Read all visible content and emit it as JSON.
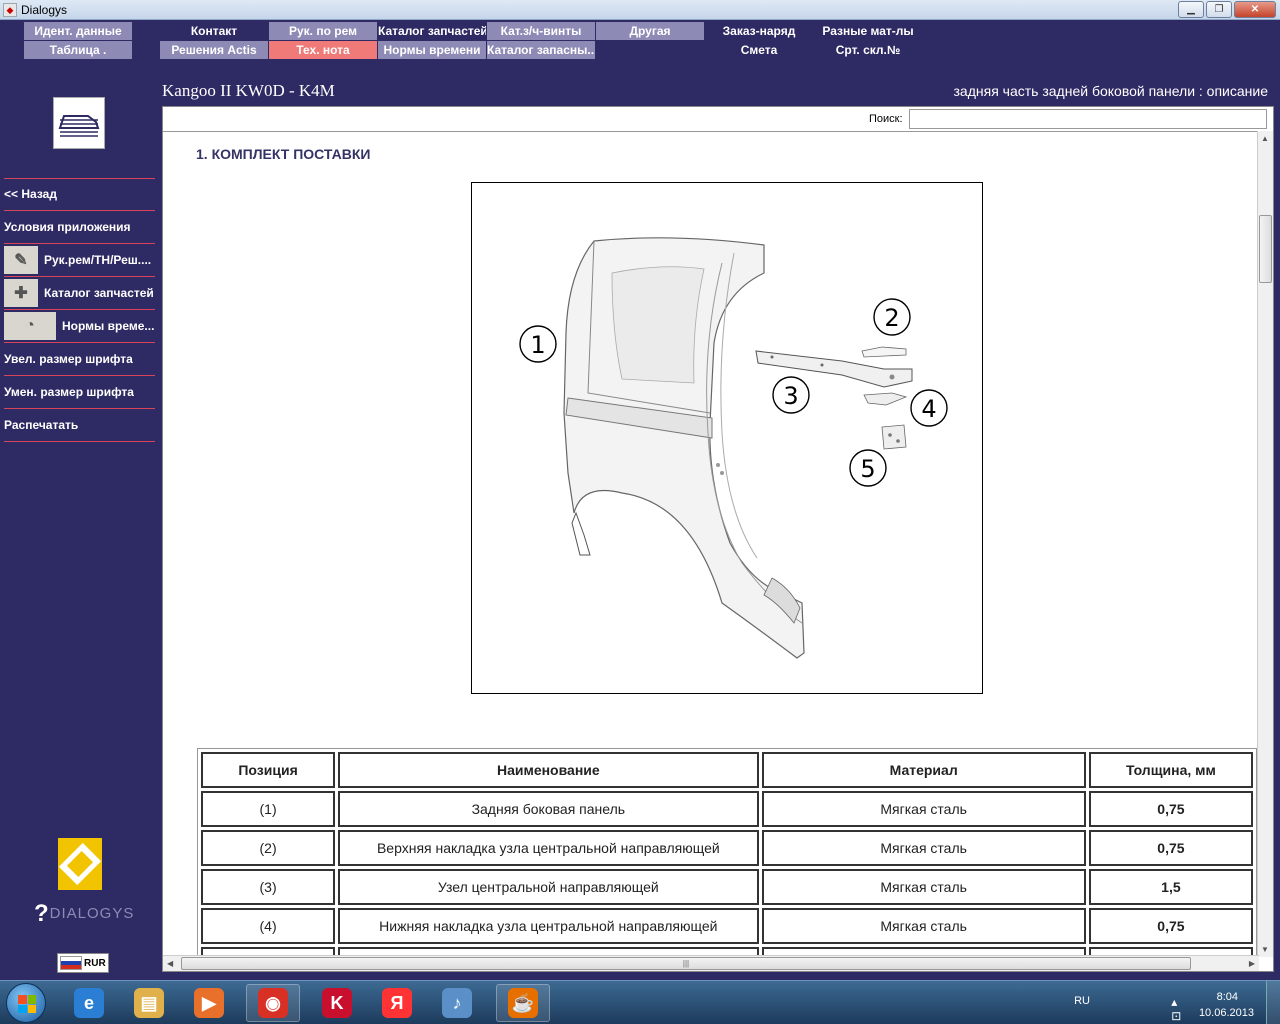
{
  "window": {
    "title": "Dialogys",
    "minimize": "▁",
    "restore": "❐",
    "close": "✕"
  },
  "nav": {
    "row1": [
      {
        "label": "Идент. данные",
        "style": "grey"
      },
      {
        "label": "Контакт",
        "style": "dark"
      },
      {
        "label": "Рук. по рем",
        "style": "grey"
      },
      {
        "label": "Каталог запчастей",
        "style": "dark"
      },
      {
        "label": "Кат.з/ч-винты",
        "style": "grey"
      },
      {
        "label": "Другая",
        "style": "grey"
      },
      {
        "label": "Заказ-наряд",
        "style": "dark"
      },
      {
        "label": "Разные мат-лы",
        "style": "dark"
      }
    ],
    "row2": [
      {
        "label": "Таблица .",
        "style": "grey"
      },
      {
        "label": "Решения Actis",
        "style": "grey"
      },
      {
        "label": "Тех. нота",
        "style": "active"
      },
      {
        "label": "Нормы времени",
        "style": "grey"
      },
      {
        "label": "Каталог запасны...",
        "style": "grey"
      },
      {
        "label": "Смета",
        "style": "dark"
      },
      {
        "label": "Срт. скл.№",
        "style": "dark"
      }
    ]
  },
  "header": {
    "model": "Kangoo II KW0D - K4M",
    "description": "задняя часть задней боковой панели : описание"
  },
  "sidebar": {
    "items": [
      {
        "label": "<< Назад",
        "icon": ""
      },
      {
        "label": "Условия приложения",
        "icon": ""
      },
      {
        "label": "Рук.рем/ТН/Реш....",
        "icon": "wrench-icon"
      },
      {
        "label": "Каталог запчастей",
        "icon": "parts-icon"
      },
      {
        "label": "Нормы време...",
        "icon": "gauge-icon"
      },
      {
        "label": "Увел. размер шрифта",
        "icon": ""
      },
      {
        "label": "Умен. размер шрифта",
        "icon": ""
      },
      {
        "label": "Распечатать",
        "icon": ""
      }
    ],
    "brand": "DIALOGYS",
    "currency": "RUR"
  },
  "search": {
    "label": "Поиск:",
    "value": ""
  },
  "content": {
    "section_title": "1. КОМПЛЕКТ ПОСТАВКИ",
    "callouts": [
      "1",
      "2",
      "3",
      "4",
      "5"
    ]
  },
  "table": {
    "headers": [
      "Позиция",
      "Наименование",
      "Материал",
      "Толщина, мм"
    ],
    "rows": [
      [
        "(1)",
        "Задняя боковая панель",
        "Мягкая сталь",
        "0,75"
      ],
      [
        "(2)",
        "Верхняя накладка узла центральной направляющей",
        "Мягкая сталь",
        "0,75"
      ],
      [
        "(3)",
        "Узел центральной направляющей",
        "Мягкая сталь",
        "1,5"
      ],
      [
        "(4)",
        "Нижняя накладка узла центральной направляющей",
        "Мягкая сталь",
        "0,75"
      ]
    ]
  },
  "taskbar": {
    "lang": "RU",
    "time": "8:04",
    "date": "10.06.2013",
    "apps": [
      {
        "name": "ie",
        "glyph": "e",
        "color": "#2a7fd4"
      },
      {
        "name": "explorer",
        "glyph": "▤",
        "color": "#e0b04a"
      },
      {
        "name": "media",
        "glyph": "▶",
        "color": "#e8702a"
      },
      {
        "name": "chrome",
        "glyph": "◉",
        "color": "#d93025"
      },
      {
        "name": "kaspersky",
        "glyph": "K",
        "color": "#c8102e"
      },
      {
        "name": "yandex",
        "glyph": "Я",
        "color": "#ff3333"
      },
      {
        "name": "sound",
        "glyph": "♪",
        "color": "#5a8fc8"
      },
      {
        "name": "java",
        "glyph": "☕",
        "color": "#e76f00"
      }
    ]
  }
}
